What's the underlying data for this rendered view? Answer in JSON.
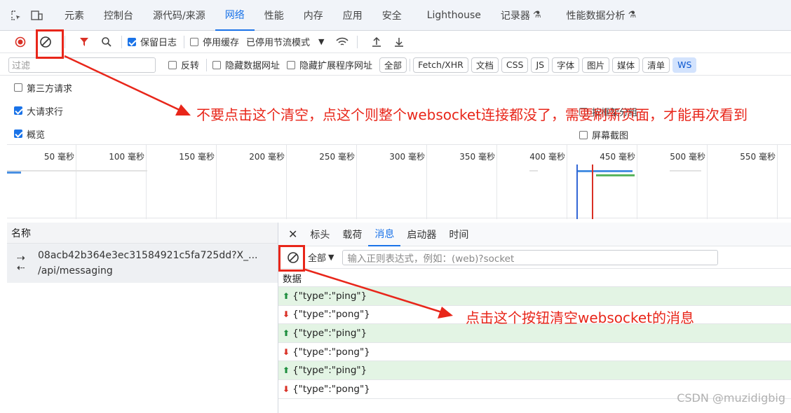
{
  "tabbar": {
    "tabs": [
      {
        "label": "元素"
      },
      {
        "label": "控制台"
      },
      {
        "label": "源代码/来源"
      },
      {
        "label": "网络"
      },
      {
        "label": "性能"
      },
      {
        "label": "内存"
      },
      {
        "label": "应用"
      },
      {
        "label": "安全"
      },
      {
        "label": "Lighthouse"
      },
      {
        "label": "记录器"
      },
      {
        "label": "性能数据分析"
      }
    ],
    "active": "网络"
  },
  "toolbar": {
    "preserve_log": "保留日志",
    "disable_cache": "停用缓存",
    "throttle": "已停用节流模式"
  },
  "filterbar": {
    "placeholder": "过滤",
    "invert": "反转",
    "hide_data_urls": "隐藏数据网址",
    "hide_ext_urls": "隐藏扩展程序网址",
    "types": [
      "全部",
      "Fetch/XHR",
      "文档",
      "CSS",
      "JS",
      "字体",
      "图片",
      "媒体",
      "清单",
      "WS"
    ],
    "active_type": "WS"
  },
  "options": {
    "third_party": "第三方请求",
    "big_rows": "大请求行",
    "overview": "概览",
    "group_by_frame": "按框架分组",
    "screenshots": "屏幕截图"
  },
  "timeline": {
    "ticks": [
      "50 毫秒",
      "100 毫秒",
      "150 毫秒",
      "200 毫秒",
      "250 毫秒",
      "300 毫秒",
      "350 毫秒",
      "400 毫秒",
      "450 毫秒",
      "500 毫秒",
      "550 毫秒"
    ]
  },
  "requests": {
    "header": "名称",
    "items": [
      {
        "name": "08acb42b364e3ec31584921c5fa725dd?X_...",
        "path": "/api/messaging"
      }
    ]
  },
  "detail": {
    "tabs": [
      "标头",
      "载荷",
      "消息",
      "启动器",
      "时间"
    ],
    "active_tab": "消息",
    "filter_select": "全部",
    "search_placeholder": "输入正则表达式，例如：(web)?socket",
    "column": "数据",
    "messages": [
      {
        "dir": "sent",
        "data": "{\"type\":\"ping\"}"
      },
      {
        "dir": "recv",
        "data": "{\"type\":\"pong\"}"
      },
      {
        "dir": "sent",
        "data": "{\"type\":\"ping\"}"
      },
      {
        "dir": "recv",
        "data": "{\"type\":\"pong\"}"
      },
      {
        "dir": "sent",
        "data": "{\"type\":\"ping\"}"
      },
      {
        "dir": "recv",
        "data": "{\"type\":\"pong\"}"
      }
    ]
  },
  "annotations": {
    "note1": "不要点击这个清空，点这个则整个websocket连接都没了，需要刷新页面，才能再次看到",
    "note2": "点击这个按钮清空websocket的消息",
    "color": "#e8261a"
  },
  "watermark": "CSDN @muzidigbig"
}
